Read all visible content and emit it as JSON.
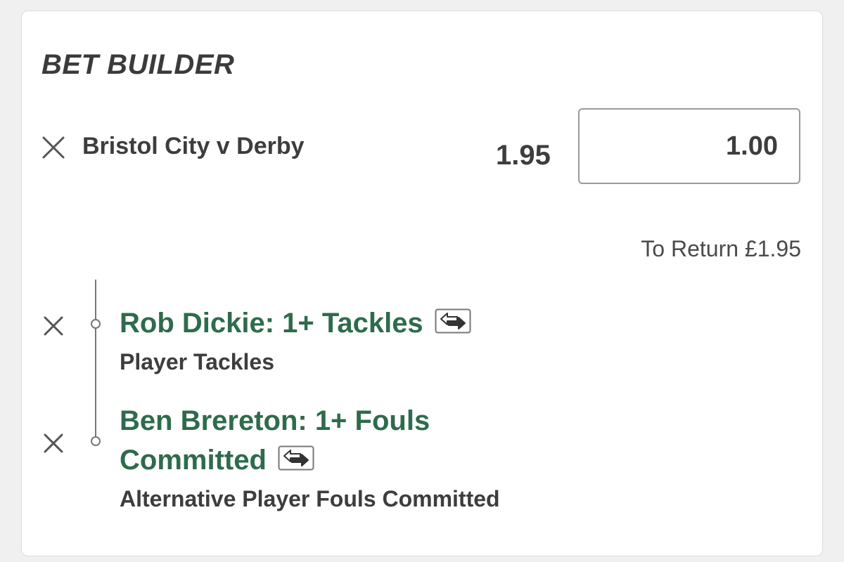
{
  "panel": {
    "title": "BET BUILDER",
    "match": "Bristol City v Derby",
    "odds": "1.95",
    "stake_value": "1.00",
    "to_return": "To Return £1.95"
  },
  "selections": [
    {
      "title": "Rob Dickie: 1+ Tackles",
      "market": "Player Tackles"
    },
    {
      "title_line1": "Ben Brereton: 1+ Fouls",
      "title_line2": "Committed",
      "market": "Alternative Player Fouls Committed"
    }
  ],
  "icons": {
    "remove": "close-icon",
    "swap": "swap-icon"
  },
  "colors": {
    "accent_green": "#2e6b4c",
    "text_dark": "#3d3d3d"
  }
}
